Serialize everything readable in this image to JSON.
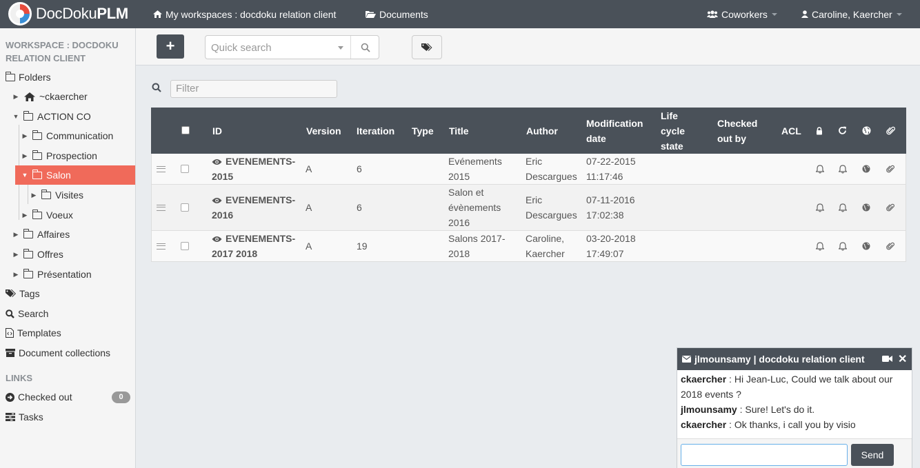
{
  "navbar": {
    "brand_light": "DocDoku",
    "brand_bold": "PLM",
    "workspaces_label": "My workspaces : docdoku relation client",
    "documents_label": "Documents",
    "coworkers_label": "Coworkers",
    "user_label": "Caroline, Kaercher"
  },
  "sidebar": {
    "workspace_title": "WORKSPACE : DOCDOKU RELATION CLIENT",
    "folders_label": "Folders",
    "tree": [
      {
        "label": "~ckaercher"
      },
      {
        "label": "ACTION CO"
      },
      {
        "label": "Communication"
      },
      {
        "label": "Prospection"
      },
      {
        "label": "Salon"
      },
      {
        "label": "Visites"
      },
      {
        "label": "Voeux"
      },
      {
        "label": "Affaires"
      },
      {
        "label": "Offres"
      },
      {
        "label": "Présentation"
      }
    ],
    "tags_label": "Tags",
    "search_label": "Search",
    "templates_label": "Templates",
    "collections_label": "Document collections",
    "links_title": "LINKS",
    "checked_out_label": "Checked out",
    "checked_out_count": "0",
    "tasks_label": "Tasks"
  },
  "toolbar": {
    "add_label": "+",
    "quick_search_placeholder": "Quick search"
  },
  "filter": {
    "placeholder": "Filter"
  },
  "table": {
    "headers": {
      "id": "ID",
      "version": "Version",
      "iteration": "Iteration",
      "type": "Type",
      "title": "Title",
      "author": "Author",
      "modification_date": "Modification date",
      "lifecycle_state": "Life cycle state",
      "checked_out_by": "Checked out by",
      "acl": "ACL"
    },
    "rows": [
      {
        "id": "EVENEMENTS-2015",
        "version": "A",
        "iteration": "6",
        "type": "",
        "title": "Evénements 2015",
        "author": "Eric Descargues",
        "date": "07-22-2015",
        "time": "11:17:46"
      },
      {
        "id": "EVENEMENTS-2016",
        "version": "A",
        "iteration": "6",
        "type": "",
        "title": "Salon et évènements 2016",
        "author": "Eric Descargues",
        "date": "07-11-2016",
        "time": "17:02:38"
      },
      {
        "id": "EVENEMENTS-2017 2018",
        "version": "A",
        "iteration": "19",
        "type": "",
        "title": "Salons 2017-2018",
        "author": "Caroline, Kaercher",
        "date": "03-20-2018",
        "time": "17:49:07"
      }
    ]
  },
  "chat": {
    "title": "jlmounsamy | docdoku relation client",
    "messages": [
      {
        "user": "ckaercher",
        "text": " : Hi Jean-Luc, Could we talk about our 2018 events ?"
      },
      {
        "user": "jlmounsamy",
        "text": " : Sure! Let's do it."
      },
      {
        "user": "ckaercher",
        "text": " : Ok thanks, i call you by visio"
      }
    ],
    "send_label": "Send",
    "input_value": ""
  },
  "colors": {
    "navbar": "#4a5159",
    "active_folder": "#f06a5a",
    "sidebar_bg": "#f5f5f5"
  }
}
